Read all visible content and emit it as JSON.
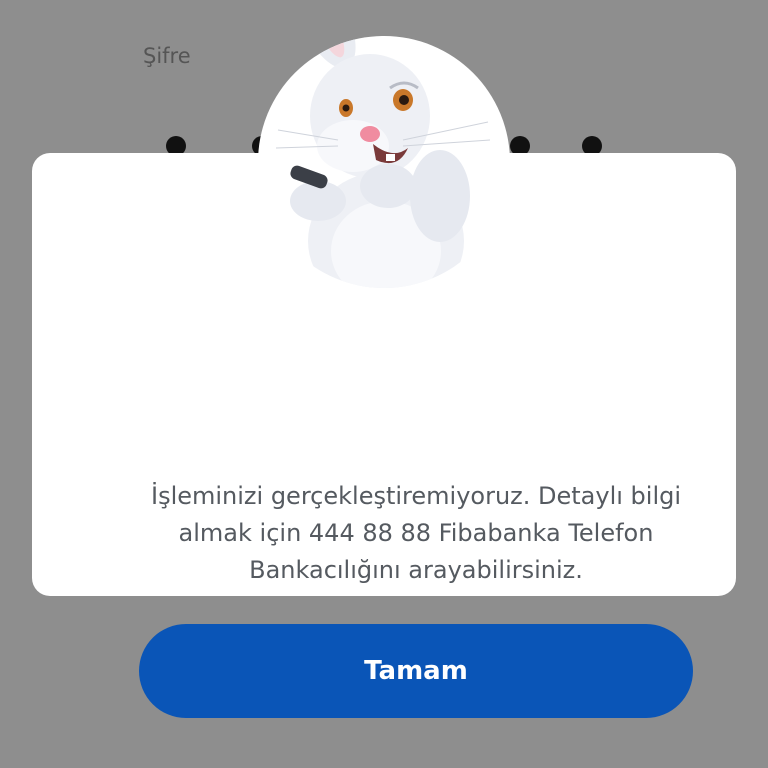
{
  "background": {
    "field_label": "Şifre",
    "pin_dot_count": 6
  },
  "dialog": {
    "mascot": "rabbit-mascot-with-phone",
    "message": "İşleminizi gerçekleştiremiyoruz. Detaylı bilgi almak için 444 88 88 Fibabanka Telefon Bankacılığını arayabilirsiniz.",
    "button_label": "Tamam"
  },
  "colors": {
    "overlay": "#8e8e8e",
    "dialog_bg": "#ffffff",
    "button_bg": "#0a55b7",
    "button_text": "#ffffff",
    "message_text": "#555a60"
  }
}
